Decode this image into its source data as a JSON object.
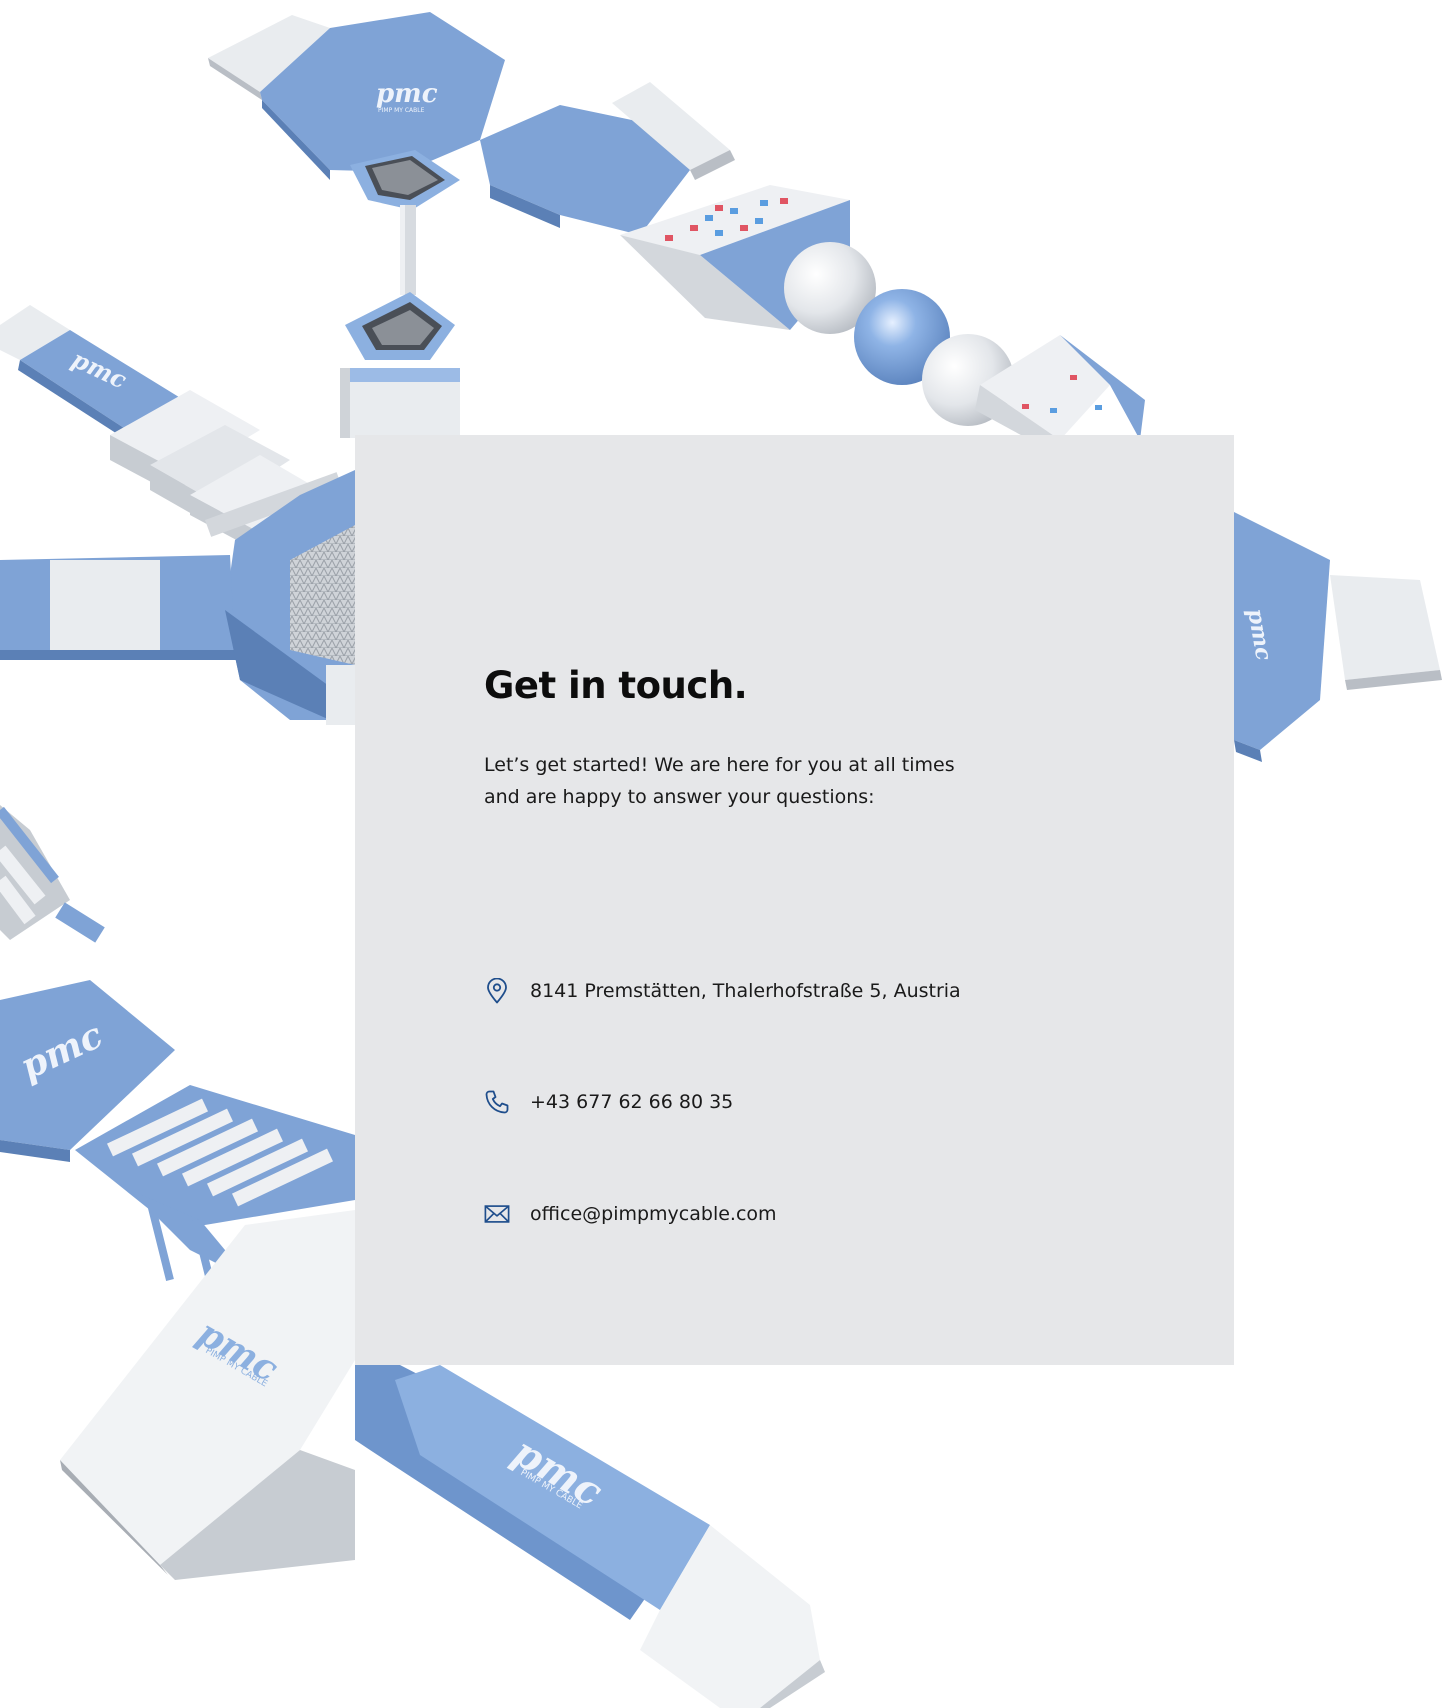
{
  "contact": {
    "heading": "Get in touch.",
    "intro_line1": "Let’s get started! We are here for you at all times",
    "intro_line2": "and are happy to answer your questions:",
    "address": "8141 Premstätten, Thalerhofstraße 5, Austria",
    "phone": "+43 677 62 66 80 35",
    "email": "office@pimpmycable.com"
  },
  "illustration": {
    "logo_text": "pmc",
    "logo_subtext": "PIMP MY CABLE"
  },
  "colors": {
    "accent_icon": "#1f4e8c",
    "card_background": "#e6e7e9",
    "module_blue": "#7fa3d6",
    "module_white": "#eceff2"
  },
  "icons": {
    "address": "map-pin-icon",
    "phone": "phone-icon",
    "email": "mail-icon"
  }
}
